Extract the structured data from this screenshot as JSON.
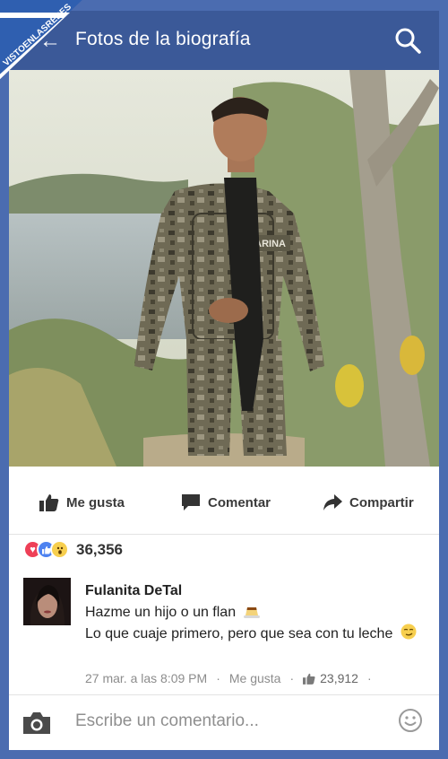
{
  "header": {
    "title": "Fotos de la biografía"
  },
  "watermark": {
    "text": "VISTOENLASREDES"
  },
  "photo": {
    "patch_text": "MARINA"
  },
  "actions": {
    "like": "Me gusta",
    "comment": "Comentar",
    "share": "Compartir"
  },
  "reactions": {
    "count": "36,356"
  },
  "comment": {
    "name": "Fulanita DeTal",
    "line1": "Hazme un hijo o un flan",
    "line2": "Lo que cuaje primero, pero que sea con tu leche",
    "time": "27 mar. a las 8:09 PM",
    "like": "Me gusta",
    "likes": "23,912"
  },
  "composer": {
    "placeholder": "Escribe un comentario..."
  },
  "colors": {
    "header": "#3b5998",
    "background": "#4b6cb0"
  },
  "icons": [
    "back-arrow-icon",
    "search-icon",
    "thumbs-up-icon",
    "comment-icon",
    "share-arrow-icon",
    "love-reaction-icon",
    "like-reaction-icon",
    "wow-reaction-icon",
    "flan-emoji-icon",
    "smirk-emoji-icon",
    "camera-icon",
    "smiley-icon"
  ]
}
